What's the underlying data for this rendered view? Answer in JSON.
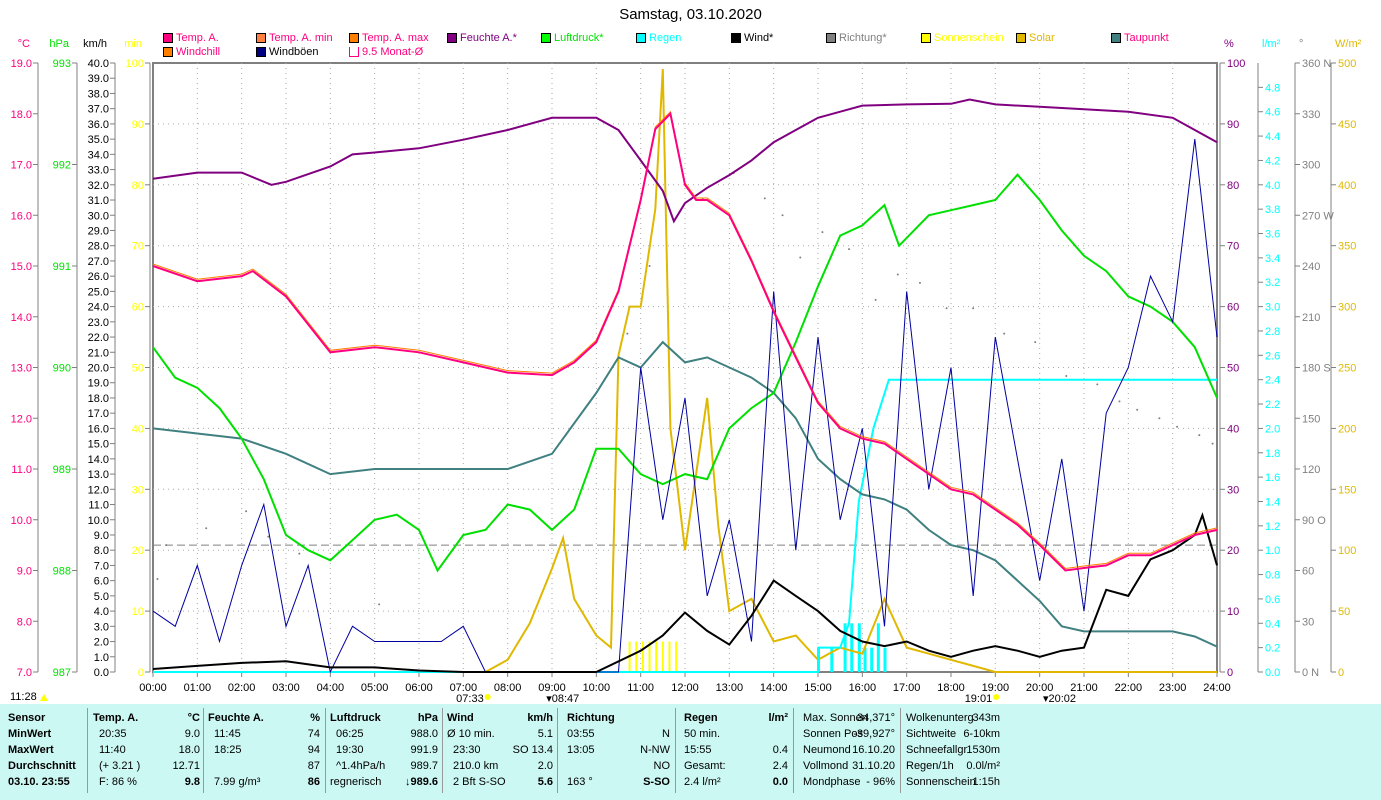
{
  "title": "Samstag, 03.10.2020",
  "legend": [
    {
      "label": "Temp. A.",
      "color": "#ff0080",
      "text": "#ff0080"
    },
    {
      "label": "Temp. A. min",
      "color": "#ff8040",
      "text": "#ff0080"
    },
    {
      "label": "Temp. A. max",
      "color": "#ff8000",
      "text": "#ff0080"
    },
    {
      "label": "Feuchte A.*",
      "color": "#800080",
      "text": "#800080"
    },
    {
      "label": "Luftdruck*",
      "color": "#00ff00",
      "text": "#00e000"
    },
    {
      "label": "Regen",
      "color": "#00ffff",
      "text": "#00ffff"
    },
    {
      "label": "Wind*",
      "color": "#000000",
      "text": "#000000"
    },
    {
      "label": "Richtung*",
      "color": "#808080",
      "text": "#808080"
    },
    {
      "label": "Sonnenschein",
      "color": "#ffff00",
      "text": "#ffff00"
    },
    {
      "label": "Solar",
      "color": "#e0b800",
      "text": "#e0b800"
    },
    {
      "label": "Taupunkt",
      "color": "#408080",
      "text": "#ff0080"
    },
    {
      "label": "Windchill",
      "color": "#ff8000",
      "text": "#ff0080"
    },
    {
      "label": "Windböen",
      "color": "#000080",
      "text": "#000000"
    },
    {
      "label": "9.5 Monat-Ø",
      "color": "#ffffff",
      "text": "#ff0080"
    }
  ],
  "chart_data": {
    "type": "line",
    "title": "Samstag, 03.10.2020",
    "x_ticks": [
      "00:00",
      "01:00",
      "02:00",
      "03:00",
      "04:00",
      "05:00",
      "06:00",
      "07:00",
      "08:00",
      "09:00",
      "10:00",
      "11:00",
      "12:00",
      "13:00",
      "14:00",
      "15:00",
      "16:00",
      "17:00",
      "18:00",
      "19:00",
      "20:00",
      "21:00",
      "22:00",
      "23:00",
      "24:00"
    ],
    "axes": {
      "temp": {
        "unit": "°C",
        "min": 7,
        "max": 19,
        "step": 1,
        "decimals": 1,
        "color": "#ff0080"
      },
      "pressure": {
        "unit": "hPa",
        "min": 987,
        "max": 993,
        "step": 1,
        "decimals": 0,
        "color": "#00e000"
      },
      "wind": {
        "unit": "km/h",
        "min": 0,
        "max": 40,
        "step": 1,
        "decimals": 1,
        "color": "#000000"
      },
      "sunshine": {
        "unit": "min",
        "min": 0,
        "max": 100,
        "step": 10,
        "decimals": 0,
        "color": "#ffff00"
      },
      "humidity": {
        "unit": "%",
        "min": 0,
        "max": 100,
        "step": 10,
        "decimals": 0,
        "color": "#800080"
      },
      "rain": {
        "unit": "l/m²",
        "min": 0,
        "max": 5,
        "step": 0.2,
        "decimals": 1,
        "color": "#00ffff"
      },
      "direction": {
        "unit": "°",
        "min": 0,
        "max": 360,
        "step": 30,
        "decimals": 0,
        "color": "#808080",
        "compass": {
          "0": "N",
          "90": "O",
          "180": "S",
          "270": "W",
          "360": "N"
        }
      },
      "solar": {
        "unit": "W/m²",
        "min": 0,
        "max": 500,
        "step": 50,
        "decimals": 0,
        "color": "#e0b800"
      }
    },
    "monthly_avg_temp": 9.5,
    "series": [
      {
        "name": "Temp. A.",
        "axis": "temp",
        "color": "#ff0080",
        "x": [
          0,
          1,
          2,
          2.25,
          3,
          4,
          5,
          6,
          7,
          8,
          9,
          9.5,
          10,
          10.5,
          11,
          11.33,
          11.67,
          12,
          12.25,
          12.5,
          13,
          13.5,
          14,
          14.5,
          15,
          15.5,
          16,
          16.5,
          17,
          17.5,
          18,
          18.5,
          19,
          19.5,
          20,
          20.58,
          21,
          21.5,
          22,
          22.5,
          23,
          23.5,
          24
        ],
        "y": [
          15.0,
          14.7,
          14.8,
          14.9,
          14.4,
          13.3,
          13.4,
          13.3,
          13.1,
          12.9,
          12.85,
          13.1,
          13.5,
          14.5,
          16.3,
          17.7,
          18.0,
          16.6,
          16.3,
          16.3,
          16.0,
          15.1,
          14.1,
          13.2,
          12.3,
          11.8,
          11.6,
          11.5,
          11.2,
          10.9,
          10.6,
          10.5,
          10.2,
          9.9,
          9.5,
          9.0,
          9.05,
          9.1,
          9.3,
          9.3,
          9.5,
          9.7,
          9.8
        ]
      },
      {
        "name": "Feuchte A.",
        "axis": "humidity",
        "color": "#800080",
        "x": [
          0,
          1,
          2,
          2.67,
          3,
          4,
          4.5,
          5,
          6,
          7,
          8,
          9,
          10,
          10.5,
          11,
          11.5,
          11.75,
          12,
          12.5,
          13,
          13.5,
          14,
          14.5,
          15,
          15.5,
          16,
          17,
          18,
          18.42,
          19,
          20,
          21,
          22,
          23,
          23.5,
          24
        ],
        "y": [
          81,
          82,
          82,
          80,
          80.5,
          83,
          85,
          85.3,
          86,
          87.4,
          89,
          91,
          91,
          89,
          84,
          79,
          74,
          77,
          79.5,
          81.6,
          84,
          87,
          89,
          91,
          92,
          93,
          93.2,
          93.3,
          94,
          93.2,
          92.8,
          92.4,
          92,
          91,
          89,
          87
        ]
      },
      {
        "name": "Luftdruck",
        "axis": "pressure",
        "color": "#00e000",
        "x": [
          0,
          0.5,
          1,
          1.5,
          2,
          2.5,
          3,
          3.5,
          4,
          4.5,
          5,
          5.5,
          6,
          6.42,
          7,
          7.5,
          8,
          8.5,
          9,
          9.5,
          10,
          10.5,
          11,
          11.5,
          12,
          12.5,
          13,
          13.5,
          14,
          14.5,
          15,
          15.5,
          16,
          16.5,
          16.83,
          17.5,
          18,
          18.5,
          19,
          19.5,
          20,
          20.5,
          21,
          21.5,
          22,
          22.5,
          23,
          23.5,
          24
        ],
        "y": [
          990.2,
          989.9,
          989.8,
          989.6,
          989.3,
          988.9,
          988.35,
          988.2,
          988.1,
          988.3,
          988.5,
          988.55,
          988.4,
          988.0,
          988.35,
          988.4,
          988.65,
          988.6,
          988.4,
          988.6,
          989.2,
          989.2,
          988.95,
          988.85,
          988.95,
          988.9,
          989.4,
          989.6,
          989.75,
          990.25,
          990.8,
          991.3,
          991.4,
          991.6,
          991.2,
          991.5,
          991.55,
          991.6,
          991.65,
          991.9,
          991.65,
          991.35,
          991.1,
          990.95,
          990.7,
          990.6,
          990.45,
          990.2,
          989.7
        ]
      },
      {
        "name": "Taupunkt",
        "axis": "temp",
        "color": "#408080",
        "x": [
          0,
          1,
          2,
          3,
          4,
          5,
          6,
          7,
          8,
          9,
          10,
          10.5,
          11,
          11.5,
          12,
          12.5,
          13,
          13.5,
          14,
          14.5,
          15,
          15.5,
          16,
          16.5,
          17,
          17.5,
          18,
          18.5,
          19,
          19.5,
          20,
          20.5,
          21,
          22,
          23,
          23.5,
          24
        ],
        "y": [
          11.8,
          11.7,
          11.6,
          11.3,
          10.9,
          11.0,
          11.0,
          11.0,
          11.0,
          11.3,
          12.5,
          13.2,
          13.0,
          13.5,
          13.1,
          13.2,
          13.0,
          12.8,
          12.5,
          12.0,
          11.2,
          10.8,
          10.5,
          10.4,
          10.2,
          9.8,
          9.5,
          9.4,
          9.2,
          8.8,
          8.4,
          7.9,
          7.8,
          7.8,
          7.8,
          7.7,
          7.5
        ]
      },
      {
        "name": "Wind",
        "axis": "wind",
        "color": "#000000",
        "x": [
          0,
          1,
          2,
          3,
          4,
          5,
          6,
          7,
          8,
          9,
          10,
          11,
          11.5,
          12,
          12.5,
          13,
          13.5,
          14,
          14.5,
          15,
          15.5,
          16,
          16.5,
          17,
          17.5,
          18,
          18.5,
          19,
          19.5,
          20,
          20.5,
          21,
          21.5,
          22,
          22.5,
          23,
          23.5,
          23.67,
          24
        ],
        "y": [
          0.2,
          0.4,
          0.6,
          0.7,
          0.3,
          0.3,
          0.1,
          0,
          0,
          0,
          0,
          1.4,
          2.4,
          3.9,
          2.7,
          1.8,
          3.7,
          6.0,
          5.0,
          4.0,
          2.7,
          2.0,
          1.7,
          2.0,
          1.4,
          1.0,
          1.4,
          1.7,
          1.4,
          1.0,
          1.4,
          1.6,
          5.4,
          5.0,
          7.4,
          8.0,
          9.0,
          10.3,
          7.0
        ]
      },
      {
        "name": "Windböen",
        "axis": "wind",
        "color": "#0000a0",
        "x": [
          0,
          0.5,
          1,
          1.5,
          2,
          2.5,
          3,
          3.5,
          4,
          4.5,
          5,
          5.5,
          6,
          6.5,
          7,
          7.5,
          8,
          8.5,
          9,
          9.5,
          10,
          10.5,
          11,
          11.5,
          12,
          12.5,
          13,
          13.5,
          14,
          14.5,
          15,
          15.5,
          16,
          16.5,
          17,
          17.5,
          18,
          18.5,
          19,
          19.5,
          20,
          20.5,
          21,
          21.5,
          22,
          22.5,
          23,
          23.5,
          24
        ],
        "y": [
          4,
          3,
          7,
          2,
          7,
          11,
          3,
          7,
          0,
          3,
          2,
          2,
          2,
          2,
          3,
          0,
          0,
          0,
          0,
          0,
          0,
          0,
          20,
          10,
          18,
          5,
          10,
          2,
          25,
          8,
          22,
          10,
          16,
          3,
          25,
          12,
          20,
          5,
          22,
          14,
          6,
          14,
          4,
          17,
          20,
          26,
          23,
          35,
          22
        ]
      },
      {
        "name": "Solar",
        "axis": "solar",
        "color": "#e0b800",
        "x": [
          0,
          7.5,
          8,
          8.5,
          9,
          9.25,
          9.5,
          10,
          10.33,
          10.5,
          10.75,
          11,
          11.33,
          11.5,
          11.67,
          12,
          12.5,
          12.75,
          13,
          13.5,
          14,
          14.5,
          15,
          15.5,
          16,
          16.5,
          17,
          17.5,
          18,
          18.5,
          19,
          24
        ],
        "y": [
          0,
          0,
          10,
          40,
          85,
          110,
          60,
          30,
          20,
          260,
          300,
          300,
          380,
          495,
          200,
          100,
          225,
          120,
          50,
          60,
          25,
          30,
          10,
          20,
          15,
          60,
          20,
          15,
          10,
          5,
          0,
          0
        ]
      },
      {
        "name": "Regen",
        "axis": "rain",
        "color": "#00ffff",
        "x": [
          0,
          15,
          15.01,
          15.5,
          15.7,
          15.92,
          16.25,
          16.6,
          24
        ],
        "y": [
          0,
          0,
          0.2,
          0.2,
          0.4,
          1.4,
          2.0,
          2.4,
          2.4
        ]
      }
    ],
    "sunshine_bars": {
      "axis": "sunshine",
      "x": [
        10.75,
        10.9,
        11.05,
        11.2,
        11.35,
        11.5,
        11.65,
        11.8
      ],
      "y": [
        5,
        5,
        5,
        5,
        5,
        5,
        5,
        5
      ]
    },
    "rain_bars": {
      "axis": "rain",
      "x": [
        15,
        15.3,
        15.6,
        15.75,
        15.92,
        16.05,
        16.2,
        16.35,
        16.5
      ],
      "y": [
        0.2,
        0.2,
        0.4,
        0.4,
        0.4,
        0.2,
        0.2,
        0.4,
        0.2
      ]
    },
    "direction_points": {
      "axis": "direction",
      "x": [
        0.1,
        0.3,
        1.2,
        2.1,
        2.6,
        3.3,
        5.1,
        10.7,
        11.2,
        12.4,
        13.1,
        13.8,
        14.2,
        14.6,
        15.1,
        15.7,
        16.3,
        16.8,
        17.3,
        17.9,
        18.5,
        19.2,
        19.9,
        20.6,
        21.3,
        21.8,
        22.2,
        22.7,
        23.1,
        23.6,
        23.9
      ],
      "y": [
        55,
        75,
        85,
        95,
        80,
        70,
        40,
        200,
        240,
        280,
        295,
        280,
        270,
        245,
        260,
        250,
        220,
        235,
        230,
        215,
        215,
        200,
        195,
        175,
        170,
        160,
        155,
        150,
        145,
        140,
        135
      ]
    },
    "markers": {
      "moon_time": "11:28",
      "sunrise": "07:33",
      "sunset": "19:01",
      "dawn_end": "08:47",
      "dusk_start": "20:02"
    }
  },
  "table": {
    "headers": {
      "sensor": "Sensor",
      "temp": "Temp. A.",
      "temp_unit": "°C",
      "hum": "Feuchte A.",
      "hum_unit": "%",
      "press": "Luftdruck",
      "press_unit": "hPa",
      "wind": "Wind",
      "wind_unit": "km/h",
      "dir": "Richtung",
      "rain": "Regen",
      "rain_unit": "l/m²"
    },
    "row_labels": [
      "MinWert",
      "MaxWert",
      "Durchschnitt",
      "03.10. 23:55"
    ],
    "temp": [
      [
        "20:35",
        "9.0"
      ],
      [
        "11:40",
        "18.0"
      ],
      [
        "(+ 3.21 )",
        "12.71"
      ],
      [
        "F: 86 %",
        "9.8"
      ]
    ],
    "hum": [
      [
        "11:45",
        "74"
      ],
      [
        "18:25",
        "94"
      ],
      [
        "",
        "87"
      ],
      [
        "7.99 g/m³",
        "86"
      ]
    ],
    "press": [
      [
        "06:25",
        "988.0"
      ],
      [
        "19:30",
        "991.9"
      ],
      [
        "^1.4hPa/h",
        "989.7"
      ],
      [
        "regnerisch",
        "↓989.6"
      ]
    ],
    "wind": [
      [
        "Ø 10 min.",
        "5.1"
      ],
      [
        "23:30",
        "SO 13.4"
      ],
      [
        "210.0 km",
        "2.0"
      ],
      [
        "2 Bft S-SO",
        "5.6"
      ]
    ],
    "dir": [
      [
        "03:55",
        "N"
      ],
      [
        "13:05",
        "N-NW"
      ],
      [
        "",
        "NO"
      ],
      [
        "163 °",
        "S-SO"
      ]
    ],
    "rain": [
      [
        "50 min.",
        ""
      ],
      [
        "15:55",
        "0.4"
      ],
      [
        "Gesamt:",
        "2.4"
      ],
      [
        "2.4 l/m²",
        "0.0"
      ]
    ],
    "astro": [
      [
        "Max. Sonnen",
        "34,371°"
      ],
      [
        "Sonnen Pos",
        "-39,927°"
      ],
      [
        "Neumond",
        "16.10.20"
      ],
      [
        "Vollmond",
        "31.10.20"
      ],
      [
        "Mondphase",
        "- 96%"
      ]
    ],
    "misc": [
      [
        "Wolkenunterg",
        "343m"
      ],
      [
        "Sichtweite",
        "6-10km"
      ],
      [
        "Schneefallgr",
        "1530m"
      ],
      [
        "Regen/1h",
        "0.0l/m²"
      ],
      [
        "Sonnenschein",
        "1:15h"
      ]
    ]
  }
}
